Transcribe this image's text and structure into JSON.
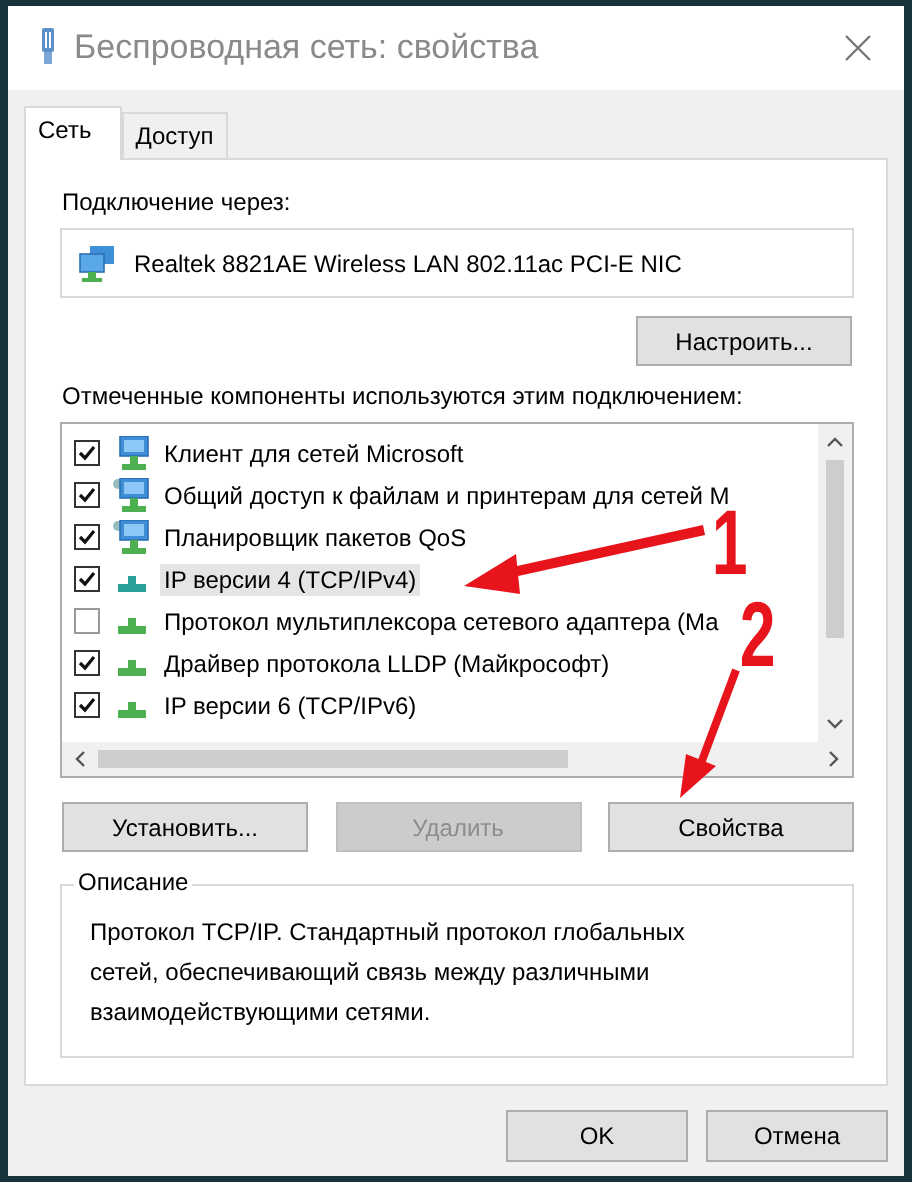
{
  "window": {
    "title": "Беспроводная сеть: свойства"
  },
  "tabs": [
    {
      "label": "Сеть",
      "selected": true
    },
    {
      "label": "Доступ",
      "selected": false
    }
  ],
  "connection": {
    "label": "Подключение через:",
    "adapter": "Realtek 8821AE Wireless LAN 802.11ac PCI-E NIC",
    "configure_button": "Настроить..."
  },
  "components": {
    "label": "Отмеченные компоненты используются этим подключением:",
    "items": [
      {
        "kind": "client",
        "label": "Клиент для сетей Microsoft",
        "checked": true,
        "selected": false
      },
      {
        "kind": "service",
        "label": "Общий доступ к файлам и принтерам для сетей M",
        "checked": true,
        "selected": false
      },
      {
        "kind": "service",
        "label": "Планировщик пакетов QoS",
        "checked": true,
        "selected": false
      },
      {
        "kind": "protocol",
        "label": "IP версии 4 (TCP/IPv4)",
        "checked": true,
        "selected": true
      },
      {
        "kind": "protocol",
        "label": "Протокол мультиплексора сетевого адаптера (Ма",
        "checked": false,
        "selected": false
      },
      {
        "kind": "protocol",
        "label": "Драйвер протокола LLDP (Майкрософт)",
        "checked": true,
        "selected": false
      },
      {
        "kind": "protocol",
        "label": "IP версии 6 (TCP/IPv6)",
        "checked": true,
        "selected": false
      }
    ]
  },
  "actions": [
    {
      "label": "Установить...",
      "disabled": false
    },
    {
      "label": "Удалить",
      "disabled": true
    },
    {
      "label": "Свойства",
      "disabled": false
    }
  ],
  "description": {
    "title": "Описание",
    "text": "Протокол TCP/IP. Стандартный протокол глобальных сетей, обеспечивающий связь между различными взаимодействующими сетями."
  },
  "buttons": [
    "OK",
    "Отмена"
  ],
  "annotations": [
    "1",
    "2"
  ]
}
